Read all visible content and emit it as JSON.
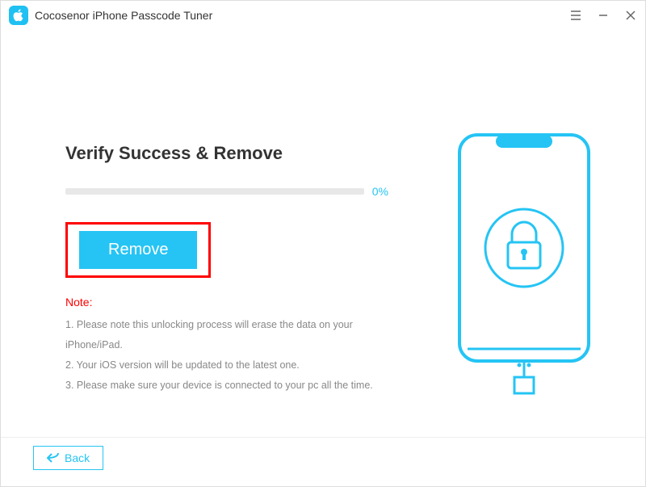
{
  "app": {
    "title": "Cocosenor iPhone Passcode Tuner"
  },
  "main": {
    "heading": "Verify Success & Remove",
    "progress": {
      "percent_label": "0%"
    },
    "remove_label": "Remove",
    "note_title": "Note:",
    "notes": [
      "1. Please note this unlocking process will erase the data on your iPhone/iPad.",
      "2. Your iOS version will be updated to the latest one.",
      "3. Please make sure your device is connected to your pc all the time."
    ]
  },
  "footer": {
    "back_label": "Back"
  }
}
